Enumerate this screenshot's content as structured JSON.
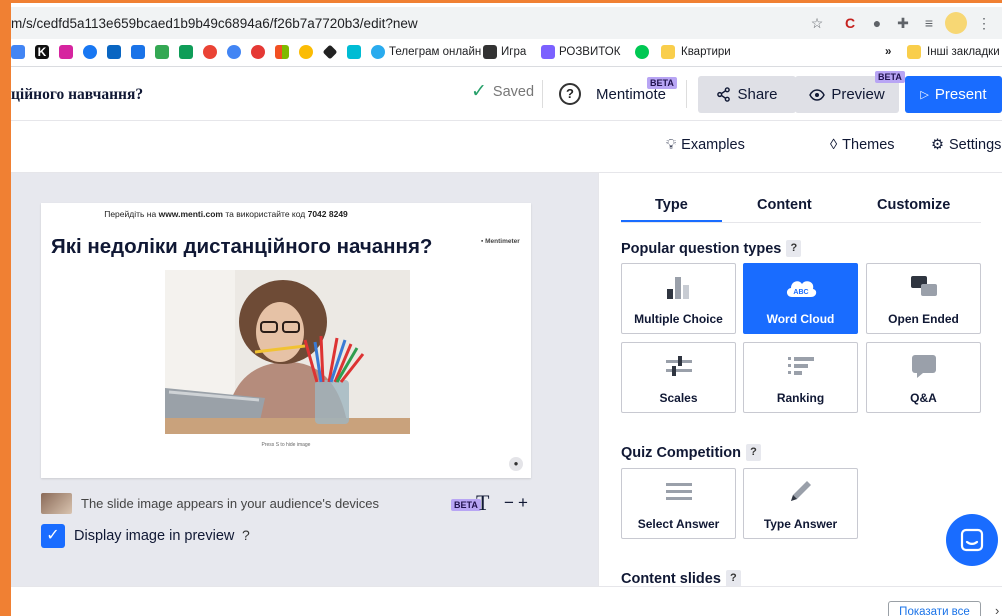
{
  "browser": {
    "url": "m/s/cedfd5a113e659bcaed1b9b49c6894a6/f26b7a7720b3/edit?new",
    "bookmarks": [
      {
        "label": "Телеграм онлайн"
      },
      {
        "label": "Игра"
      },
      {
        "label": "РОЗВИТОК"
      },
      {
        "label": "Квартири"
      },
      {
        "label": "Інші закладки"
      }
    ],
    "more_bookmarks": "»"
  },
  "header": {
    "title": "ційного навчання?",
    "saved_label": "Saved",
    "help_label": "?",
    "mentimote_label": "Mentimote",
    "beta_label": "BETA",
    "share_label": "Share",
    "preview_label": "Preview",
    "present_label": "Present"
  },
  "toolbar": {
    "examples_label": "Examples",
    "themes_label": "Themes",
    "settings_label": "Settings"
  },
  "slide": {
    "instruction_prefix": "Перейдіть на ",
    "instruction_site": "www.menti.com",
    "instruction_middle": " та використайте код ",
    "instruction_code": "7042 8249",
    "heading": "Які недоліки дистанційного начання?",
    "logo": "Mentimeter",
    "caption": "Press S to hide image"
  },
  "image_note": {
    "text": "The slide image appears in your audience's devices",
    "beta_label": "BETA",
    "text_size_icon": "T",
    "minus": "−",
    "plus": "+"
  },
  "display_preview": {
    "label": "Display image in preview",
    "help": "?",
    "checked": true
  },
  "panel": {
    "tabs": [
      "Type",
      "Content",
      "Customize"
    ],
    "active_tab": "Type",
    "popular_title": "Popular question types",
    "popular_types": [
      {
        "label": "Multiple Choice",
        "icon": "bar-chart-icon"
      },
      {
        "label": "Word Cloud",
        "icon": "word-cloud-icon",
        "selected": true
      },
      {
        "label": "Open Ended",
        "icon": "speech-bubbles-icon"
      },
      {
        "label": "Scales",
        "icon": "scales-icon"
      },
      {
        "label": "Ranking",
        "icon": "ranking-icon"
      },
      {
        "label": "Q&A",
        "icon": "qa-bubble-icon"
      }
    ],
    "quiz_title": "Quiz Competition",
    "quiz_types": [
      {
        "label": "Select Answer",
        "icon": "list-lines-icon"
      },
      {
        "label": "Type Answer",
        "icon": "pencil-icon"
      }
    ],
    "content_title": "Content slides",
    "help": "?"
  },
  "bottom": {
    "show_all_label": "Показати все"
  },
  "colors": {
    "accent": "#196cff",
    "orange_frame": "#f08033",
    "beta_badge": "#b8a5f4",
    "saved_check": "#27a06a"
  }
}
